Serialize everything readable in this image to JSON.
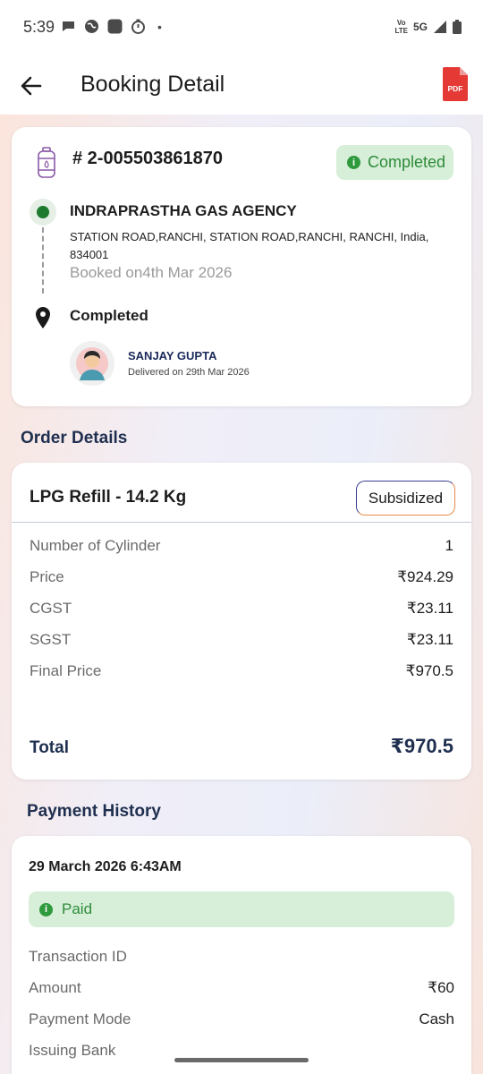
{
  "status_bar": {
    "time": "5:39",
    "dot": "•",
    "volte_line1": "Vo",
    "volte_line2": "LTE",
    "network": "5G",
    "icons": [
      "chat-icon",
      "browser-icon",
      "app-square-icon",
      "timer-icon",
      "signal-icon",
      "battery-icon"
    ]
  },
  "app_bar": {
    "title": "Booking Detail",
    "back_icon": "back-arrow-icon",
    "pdf_label": "PDF"
  },
  "booking": {
    "number": "# 2-005503861870",
    "status_badge": "Completed",
    "agency_name": "INDRAPRASTHA GAS AGENCY",
    "agency_address": "STATION ROAD,RANCHI, STATION ROAD,RANCHI, RANCHI, India, 834001",
    "booked_on": "Booked on4th Mar 2026",
    "delivery_status": "Completed",
    "delivery_person": "SANJAY GUPTA",
    "delivered_on": "Delivered on 29th Mar 2026"
  },
  "order_details": {
    "section_title": "Order Details",
    "product": "LPG Refill - 14.2 Kg",
    "tag": "Subsidized",
    "rows": [
      {
        "label": "Number of Cylinder",
        "value": "1"
      },
      {
        "label": "Price",
        "value": "₹924.29"
      },
      {
        "label": "CGST",
        "value": "₹23.11"
      },
      {
        "label": "SGST",
        "value": "₹23.11"
      },
      {
        "label": "Final Price",
        "value": "₹970.5"
      }
    ],
    "total_label": "Total",
    "total_value": "₹970.5"
  },
  "payment_history": {
    "section_title": "Payment History",
    "date": "29 March 2026 6:43AM",
    "status": "Paid",
    "rows": [
      {
        "label": "Transaction ID",
        "value": ""
      },
      {
        "label": "Amount",
        "value": "₹60"
      },
      {
        "label": "Payment Mode",
        "value": "Cash"
      },
      {
        "label": "Issuing Bank",
        "value": ""
      }
    ]
  },
  "colors": {
    "success_green": "#2e8b3a",
    "badge_bg": "#d7efd8",
    "navy": "#1f2f4f",
    "pdf_red": "#e53935"
  }
}
